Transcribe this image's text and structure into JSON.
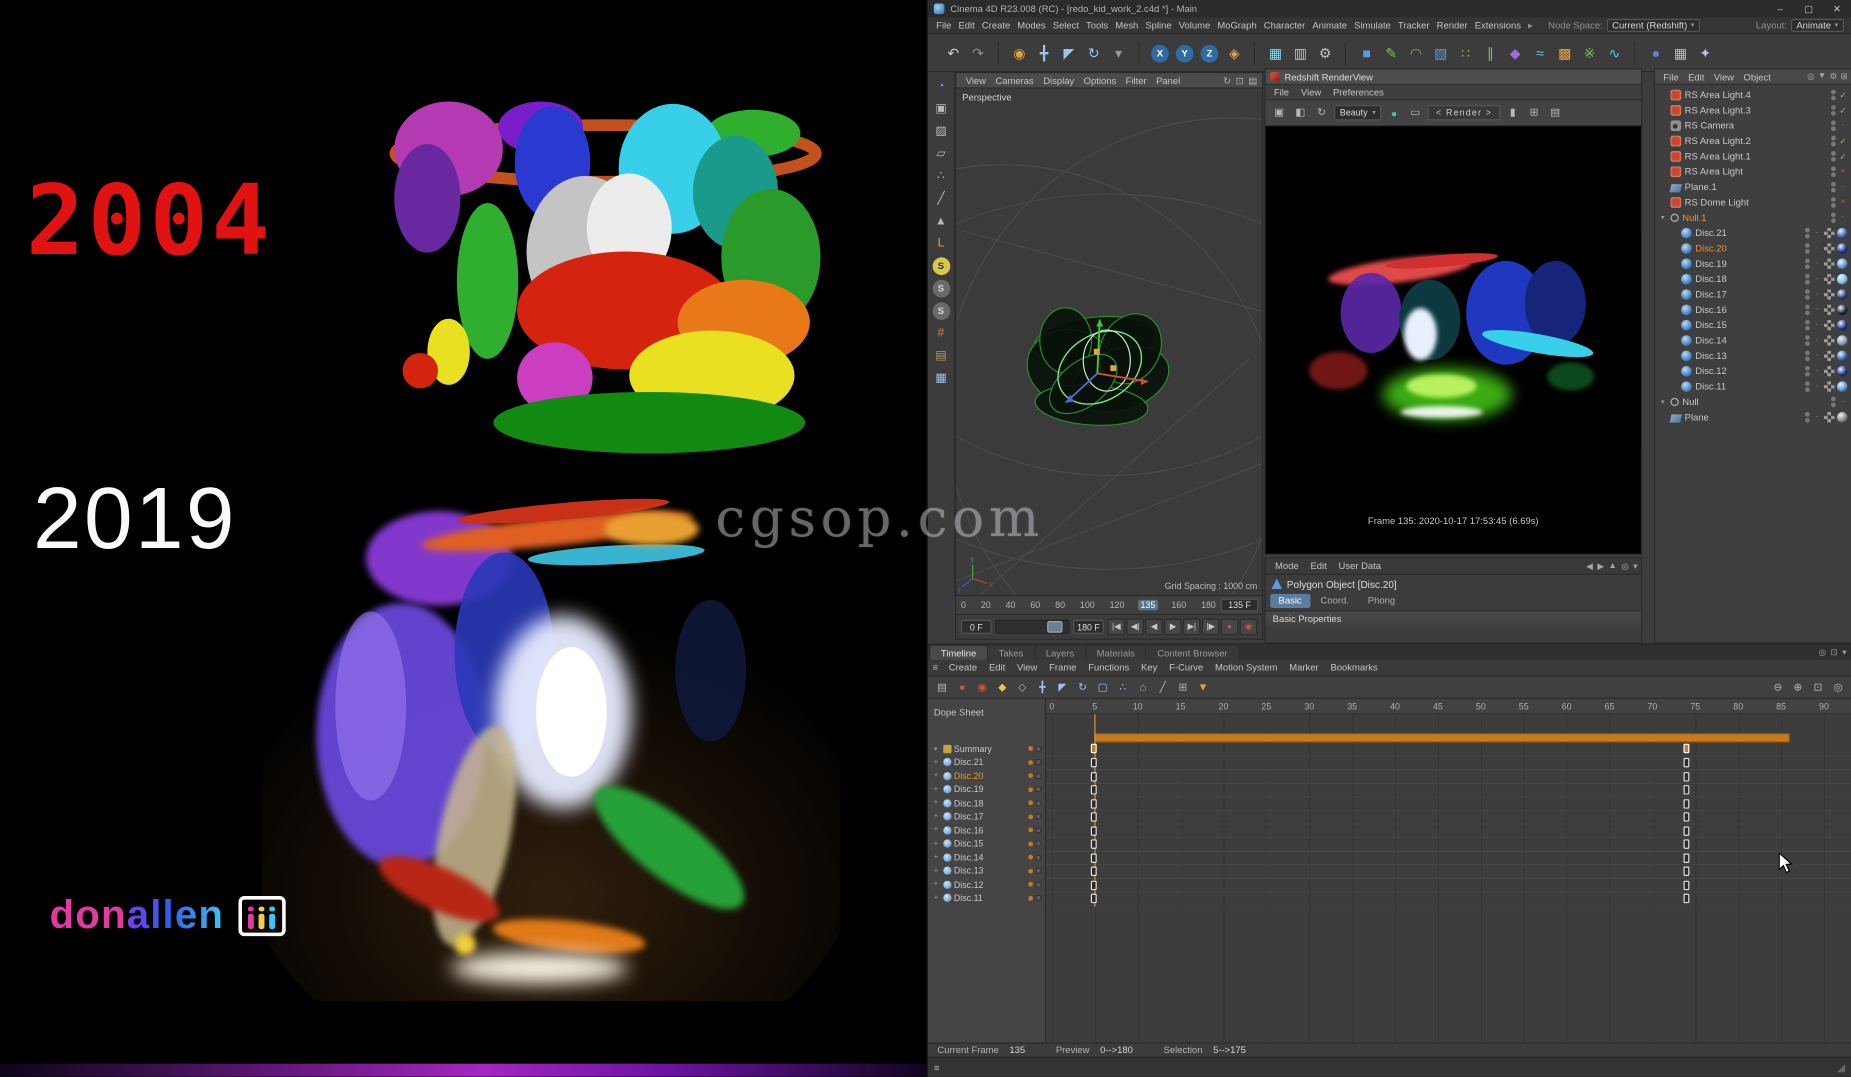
{
  "video": {
    "year_top": "2004",
    "year_bottom": "2019",
    "brand": {
      "part1": "don",
      "part2": "allen"
    },
    "watermark": "cgsop.com"
  },
  "window": {
    "title": "Cinema 4D R23.008 (RC) - [redo_kid_work_2.c4d *] - Main",
    "controls": {
      "minimize": "–",
      "maximize": "▢",
      "close": "✕"
    }
  },
  "menubar": {
    "items": [
      "File",
      "Edit",
      "Create",
      "Modes",
      "Select",
      "Tools",
      "Mesh",
      "Spline",
      "Volume",
      "MoGraph",
      "Character",
      "Animate",
      "Simulate",
      "Tracker",
      "Render",
      "Extensions"
    ],
    "overflow_glyph": "▸",
    "node_space_label": "Node Space:",
    "node_space_value": "Current (Redshift)",
    "layout_label": "Layout:",
    "layout_value": "Animate"
  },
  "main_toolbar": [
    {
      "name": "undo",
      "glyph": "↶",
      "color": "#cfcfcf"
    },
    {
      "name": "redo",
      "glyph": "↷",
      "color": "#8f8f8f"
    },
    {
      "sep": true
    },
    {
      "name": "live-selection",
      "glyph": "◉",
      "color": "#e8a23c"
    },
    {
      "name": "move-tool",
      "glyph": "╋",
      "color": "#9ec1ef"
    },
    {
      "name": "scale-tool",
      "glyph": "◤",
      "color": "#9ec1ef"
    },
    {
      "name": "rotate-tool",
      "glyph": "↻",
      "color": "#9ec1ef"
    },
    {
      "name": "last-tool",
      "glyph": "▾",
      "color": "#9a9a9a"
    },
    {
      "sep": true
    },
    {
      "name": "x-axis-lock",
      "glyph": "X",
      "color": "#ffffff",
      "chip": "#2e6da4"
    },
    {
      "name": "y-axis-lock",
      "glyph": "Y",
      "color": "#ffffff",
      "chip": "#2e6da4"
    },
    {
      "name": "z-axis-lock",
      "glyph": "Z",
      "color": "#ffffff",
      "chip": "#2e6da4"
    },
    {
      "name": "coordinate-system",
      "glyph": "◈",
      "color": "#e8a23c"
    },
    {
      "sep": true
    },
    {
      "name": "render-active-view",
      "glyph": "▦",
      "color": "#8fd4e8"
    },
    {
      "name": "render-picture-viewer",
      "glyph": "▥",
      "color": "#8fd4e8"
    },
    {
      "name": "render-settings",
      "glyph": "⚙",
      "color": "#c0c0c0"
    },
    {
      "sep": true
    },
    {
      "name": "primitive-cube",
      "glyph": "■",
      "color": "#5a9ae0"
    },
    {
      "name": "pen-tool",
      "glyph": "✎",
      "color": "#7ac24a"
    },
    {
      "name": "spline-tool",
      "glyph": "◠",
      "color": "#7ac24a"
    },
    {
      "name": "subdivision-surface",
      "glyph": "▧",
      "color": "#5a9ae0"
    },
    {
      "name": "array-generator",
      "glyph": "∷",
      "color": "#7ac24a"
    },
    {
      "name": "symmetry-generator",
      "glyph": "∥",
      "color": "#7ac24a"
    },
    {
      "name": "deformer",
      "glyph": "◆",
      "color": "#9a6ae0"
    },
    {
      "name": "field-object",
      "glyph": "≈",
      "color": "#5ac8e8"
    },
    {
      "name": "volume-builder",
      "glyph": "▩",
      "color": "#e8a23c"
    },
    {
      "name": "mograph-cloner",
      "glyph": "※",
      "color": "#7ac24a"
    },
    {
      "name": "simulation",
      "glyph": "∿",
      "color": "#5ac8e8"
    },
    {
      "sep": true
    },
    {
      "name": "material-nodes",
      "glyph": "●",
      "color": "#5a82d8"
    },
    {
      "name": "layout-grid",
      "glyph": "▦",
      "color": "#9ac4e8"
    },
    {
      "name": "viewport-solo",
      "glyph": "✦",
      "color": "#c8b4e8"
    }
  ],
  "left_toolbar": [
    {
      "name": "make-editable",
      "glyph": "◔",
      "color": "#5a9ae0"
    },
    {
      "name": "model-mode",
      "glyph": "▣",
      "color": "#b8b8b8"
    },
    {
      "name": "texture-mode",
      "glyph": "▨",
      "color": "#b8b8b8"
    },
    {
      "name": "workplane-mode",
      "glyph": "▱",
      "color": "#b8b8b8"
    },
    {
      "name": "point-mode",
      "glyph": "∴",
      "color": "#b8b8b8"
    },
    {
      "name": "edge-mode",
      "glyph": "╱",
      "color": "#b8b8b8"
    },
    {
      "name": "polygon-mode",
      "glyph": "▲",
      "color": "#b8b8b8"
    },
    {
      "name": "axis-modification",
      "glyph": "L",
      "color": "#e8a23c"
    },
    {
      "name": "enable-snap",
      "glyph": "S",
      "color": "#2c2c2c",
      "chip": "#d8c84a"
    },
    {
      "name": "snap-modes",
      "glyph": "S",
      "color": "#d8d8d8",
      "chip": "#6a6a6a"
    },
    {
      "name": "quantize",
      "glyph": "S",
      "color": "#d8d8d8",
      "chip": "#6a6a6a"
    },
    {
      "name": "workplane-tool",
      "glyph": "#",
      "color": "#e87a2e"
    },
    {
      "name": "texture-paint",
      "glyph": "▤",
      "color": "#b89a6a"
    },
    {
      "name": "viewport-filter",
      "glyph": "▦",
      "color": "#9ac4e8"
    }
  ],
  "viewport": {
    "menu": [
      "View",
      "Cameras",
      "Display",
      "Options",
      "Filter",
      "Panel"
    ],
    "corner_icons": [
      {
        "name": "sync-view",
        "glyph": "↻"
      },
      {
        "name": "toggle-single-view",
        "glyph": "⊡"
      },
      {
        "name": "panel-menu",
        "glyph": "▤"
      }
    ],
    "camera": "Perspective",
    "grid_spacing": "Grid Spacing : 1000 cm",
    "axis_x": "x",
    "axis_y": "y",
    "axis_z": "z",
    "ruler": [
      "0",
      "20",
      "40",
      "60",
      "80",
      "100",
      "120",
      "135",
      "160",
      "180"
    ],
    "current_tick": "135",
    "current_frame_field": "135 F"
  },
  "transport": {
    "start": "0 F",
    "end": "180 F",
    "buttons": [
      {
        "name": "goto-start",
        "glyph": "|◀"
      },
      {
        "name": "previous-key",
        "glyph": "◀|"
      },
      {
        "name": "previous-frame",
        "glyph": "◀"
      },
      {
        "name": "play",
        "glyph": "▶"
      },
      {
        "name": "next-frame",
        "glyph": "▶|"
      },
      {
        "name": "next-key",
        "glyph": "|▶"
      },
      {
        "name": "record-keyframe",
        "glyph": "●",
        "rec": true
      },
      {
        "name": "autokeying",
        "glyph": "◉",
        "rec": true
      }
    ]
  },
  "renderview": {
    "title": "Redshift RenderView",
    "menu": [
      "File",
      "View",
      "Preferences"
    ],
    "aov": "Beauty",
    "render_nav": "< Render >",
    "toolbar": [
      {
        "name": "save-image",
        "glyph": "▣"
      },
      {
        "name": "snapshot-compare",
        "glyph": "◧"
      },
      {
        "name": "restart-render",
        "glyph": "↻"
      },
      {
        "kind": "select"
      },
      {
        "name": "ipr-indicator",
        "glyph": "●",
        "color": "#3ac8b4"
      },
      {
        "name": "region-render",
        "glyph": "▭"
      },
      {
        "kind": "nav"
      },
      {
        "name": "lock-render",
        "glyph": "▮"
      },
      {
        "name": "display-grid",
        "glyph": "⊞"
      },
      {
        "name": "display-list",
        "glyph": "▤"
      }
    ],
    "frame_info": "Frame 135: 2020-10-17 17:53:45 (6.69s)"
  },
  "attributes": {
    "menu": [
      "Mode",
      "Edit",
      "User Data"
    ],
    "corner_icons": [
      {
        "name": "nav-back",
        "glyph": "◀"
      },
      {
        "name": "nav-forward",
        "glyph": "▶"
      },
      {
        "name": "nav-up",
        "glyph": "▲"
      },
      {
        "name": "find",
        "glyph": "◎"
      },
      {
        "name": "more",
        "glyph": "▾"
      }
    ],
    "title": "Polygon Object [Disc.20]",
    "tabs": [
      "Basic",
      "Coord.",
      "Phong"
    ],
    "active_tab": "Basic",
    "section": "Basic Properties"
  },
  "object_manager": {
    "menu": [
      "File",
      "Edit",
      "View",
      "Object"
    ],
    "corner_icons": [
      {
        "name": "search",
        "glyph": "◎"
      },
      {
        "name": "filter",
        "glyph": "▼"
      },
      {
        "name": "settings",
        "glyph": "⚙"
      },
      {
        "name": "add",
        "glyph": "⊞"
      }
    ],
    "objects": [
      {
        "name": "RS Area Light.4",
        "icon": "light",
        "state": "check"
      },
      {
        "name": "RS Area Light.3",
        "icon": "light",
        "state": "check"
      },
      {
        "name": "RS Camera",
        "icon": "camera",
        "state": "dot"
      },
      {
        "name": "RS Area Light.2",
        "icon": "light",
        "state": "check"
      },
      {
        "name": "RS Area Light.1",
        "icon": "light",
        "state": "check"
      },
      {
        "name": "RS Area Light",
        "icon": "light",
        "state": "cross"
      },
      {
        "name": "Plane.1",
        "icon": "plane",
        "state": "dot"
      },
      {
        "name": "RS Dome Light",
        "icon": "light",
        "state": "cross"
      },
      {
        "name": "Null.1",
        "icon": "nullobj",
        "state": "dot",
        "selected": true,
        "expand": true
      },
      {
        "name": "Disc.21",
        "icon": "disc",
        "level": 1,
        "state": "dot",
        "ball": "#3a66b0"
      },
      {
        "name": "Disc.20",
        "icon": "disc",
        "level": 1,
        "state": "dot",
        "ball": "#23348c",
        "selected": true
      },
      {
        "name": "Disc.19",
        "icon": "disc",
        "level": 1,
        "state": "dot",
        "ball": "#5a9ad9"
      },
      {
        "name": "Disc.18",
        "icon": "disc",
        "level": 1,
        "state": "dot",
        "ball": "#7ac4ea"
      },
      {
        "name": "Disc.17",
        "icon": "disc",
        "level": 1,
        "state": "dot",
        "ball": "#2a3a7a"
      },
      {
        "name": "Disc.16",
        "icon": "disc",
        "level": 1,
        "state": "dot",
        "ball": "#1c2430"
      },
      {
        "name": "Disc.15",
        "icon": "disc",
        "level": 1,
        "state": "dot",
        "ball": "#23348c"
      },
      {
        "name": "Disc.14",
        "icon": "disc",
        "level": 1,
        "state": "dot",
        "ball": "#8a9ab0"
      },
      {
        "name": "Disc.13",
        "icon": "disc",
        "level": 1,
        "state": "dot",
        "ball": "#3a66b0"
      },
      {
        "name": "Disc.12",
        "icon": "disc",
        "level": 1,
        "state": "dot",
        "ball": "#23348c"
      },
      {
        "name": "Disc.11",
        "icon": "disc",
        "level": 1,
        "state": "dot",
        "ball": "#5a9ad9"
      },
      {
        "name": "Null",
        "icon": "nullobj",
        "state": "dot",
        "expand": true
      },
      {
        "name": "Plane",
        "icon": "plane",
        "state": "dot",
        "ball": "#8a8a8a"
      }
    ]
  },
  "timeline": {
    "tabs": [
      "Timeline",
      "Takes",
      "Layers",
      "Materials",
      "Content Browser"
    ],
    "active_tab": "Timeline",
    "tab_corner_icons": [
      {
        "name": "search",
        "glyph": "◎"
      },
      {
        "name": "detach",
        "glyph": "⊡"
      },
      {
        "name": "more",
        "glyph": "▾"
      }
    ],
    "menu": [
      "Create",
      "Edit",
      "View",
      "Frame",
      "Functions",
      "Key",
      "F-Curve",
      "Motion System",
      "Marker",
      "Bookmarks"
    ],
    "toolbar": [
      {
        "name": "key-snapshot",
        "glyph": "▤",
        "color": "#b8b8b8"
      },
      {
        "name": "record-active-objects",
        "glyph": "●",
        "color": "#d2543c"
      },
      {
        "name": "autokeying",
        "glyph": "◉",
        "color": "#d2543c"
      },
      {
        "name": "keyframe-selection",
        "glyph": "◆",
        "color": "#e8c84a"
      },
      {
        "name": "delete-key",
        "glyph": "◇",
        "color": "#b8b8b8"
      },
      {
        "name": "record-position",
        "glyph": "╋",
        "color": "#9ec1ef"
      },
      {
        "name": "record-scale",
        "glyph": "◤",
        "color": "#9ec1ef"
      },
      {
        "name": "record-rotation",
        "glyph": "↻",
        "color": "#9ec1ef"
      },
      {
        "name": "record-parameter",
        "glyph": "▢",
        "color": "#9ec1ef"
      },
      {
        "name": "record-point-level",
        "glyph": "∴",
        "color": "#9ec1ef"
      },
      {
        "name": "key-interpolation",
        "glyph": "⌂",
        "color": "#b8b8b8"
      },
      {
        "name": "linear-interpolation",
        "glyph": "╱",
        "color": "#b8b8b8"
      },
      {
        "name": "ripple-edit",
        "glyph": "⊞",
        "color": "#b8b8b8"
      },
      {
        "name": "marker-add",
        "glyph": "▼",
        "color": "#e8a23c"
      }
    ],
    "right_toolbar": [
      {
        "name": "zoom-out",
        "glyph": "⊖",
        "color": "#b8b8b8"
      },
      {
        "name": "zoom-in",
        "glyph": "⊕",
        "color": "#b8b8b8"
      },
      {
        "name": "frame-all",
        "glyph": "⊡",
        "color": "#b8b8b8"
      },
      {
        "name": "frame-selected",
        "glyph": "◎",
        "color": "#b8b8b8"
      }
    ],
    "dope_sheet": "Dope Sheet",
    "summary": "Summary",
    "tracks": [
      "Disc.21",
      "Disc.20",
      "Disc.19",
      "Disc.18",
      "Disc.17",
      "Disc.16",
      "Disc.15",
      "Disc.14",
      "Disc.13",
      "Disc.12",
      "Disc.11"
    ],
    "selected_track": "Disc.20",
    "ruler_start": 0,
    "ruler_end": 90,
    "ruler_step": 5,
    "keyframes": [
      5,
      74
    ],
    "summary_range": [
      5,
      86
    ]
  },
  "statusbar": {
    "fields": [
      {
        "label": "Current Frame",
        "value": "135"
      },
      {
        "label": "Preview",
        "value": "0-->180"
      },
      {
        "label": "Selection",
        "value": "5-->175"
      }
    ]
  },
  "colors": {
    "accent_orange": "#e8922e",
    "selection_blue": "#5b7da1",
    "brand_pink": "#e23a9e",
    "brand_cyan": "#3ec6f2"
  }
}
